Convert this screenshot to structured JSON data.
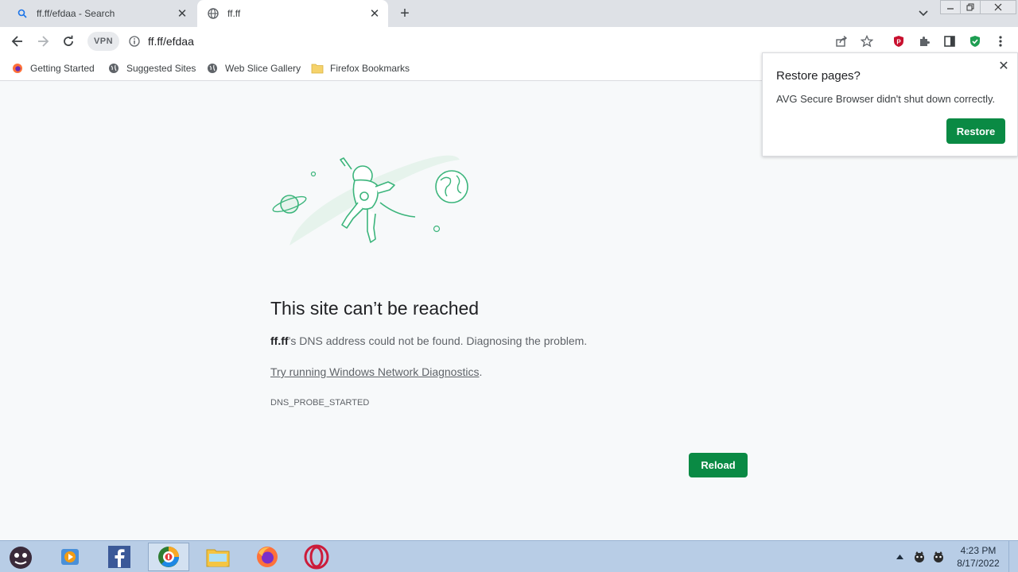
{
  "tabs": [
    {
      "title": "ff.ff/efdaa - Search",
      "icon": "search-icon",
      "active": false
    },
    {
      "title": "ff.ff",
      "icon": "globe-icon",
      "active": true
    }
  ],
  "toolbar": {
    "vpn_label": "VPN",
    "url": "ff.ff/efdaa"
  },
  "bookmarks": [
    {
      "label": "Getting Started",
      "icon": "firefox-icon"
    },
    {
      "label": "Suggested Sites",
      "icon": "globe-icon"
    },
    {
      "label": "Web Slice Gallery",
      "icon": "globe-icon"
    },
    {
      "label": "Firefox Bookmarks",
      "icon": "folder-icon"
    }
  ],
  "error": {
    "title": "This site can’t be reached",
    "host": "ff.ff",
    "description_rest": "’s DNS address could not be found. Diagnosing the problem.",
    "link_text": "Try running Windows Network Diagnostics",
    "link_suffix": ".",
    "code": "DNS_PROBE_STARTED",
    "reload_label": "Reload"
  },
  "popup": {
    "title": "Restore pages?",
    "message": "AVG Secure Browser didn't shut down correctly.",
    "restore_label": "Restore"
  },
  "taskbar": {
    "time": "4:23 PM",
    "date": "8/17/2022"
  },
  "colors": {
    "accent_green": "#0a8a44",
    "illustration_green": "#3cb57c"
  }
}
